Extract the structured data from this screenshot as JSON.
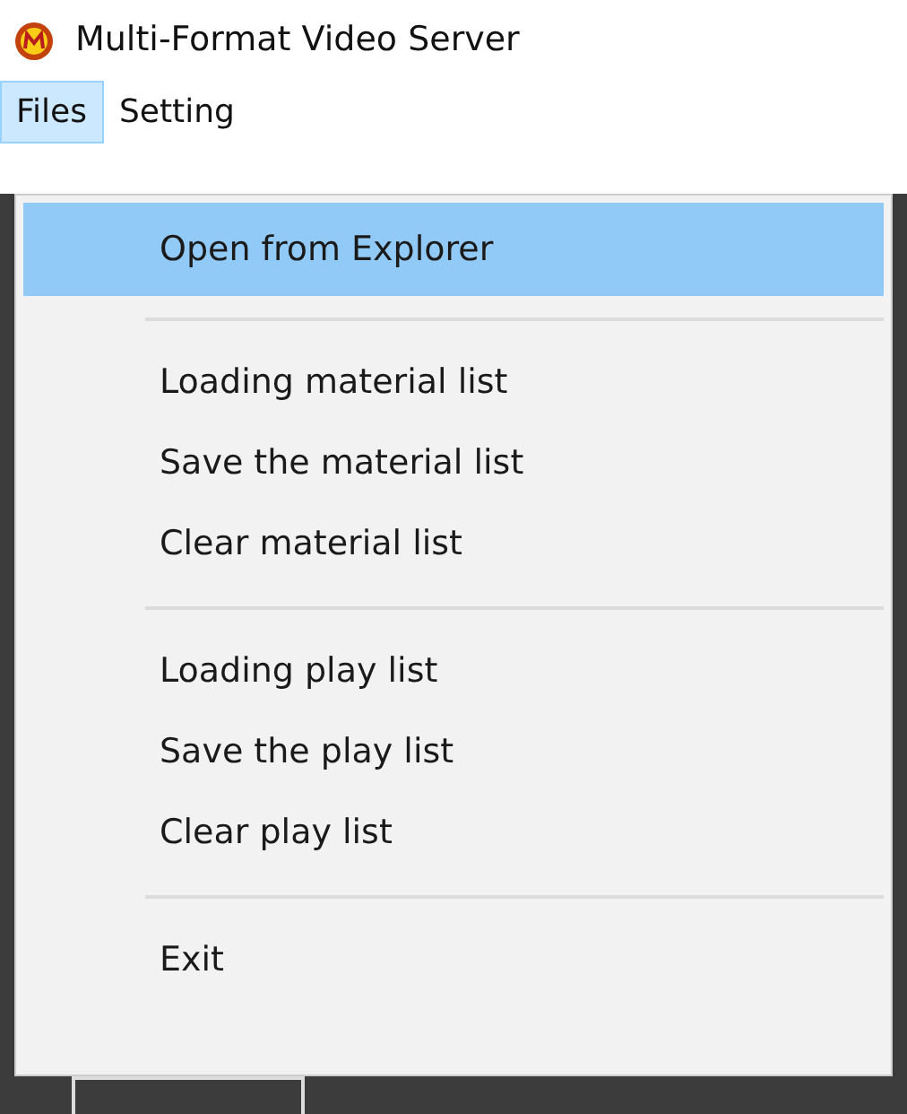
{
  "window": {
    "title": "Multi-Format Video Server"
  },
  "menu_bar": [
    {
      "label": "Files",
      "selected": true
    },
    {
      "label": "Setting",
      "selected": false
    }
  ],
  "menu": [
    {
      "kind": "item",
      "label": "Open from Explorer",
      "selected": true
    },
    {
      "kind": "separator"
    },
    {
      "kind": "item",
      "label": "Loading material list",
      "selected": false
    },
    {
      "kind": "item",
      "label": "Save the material list",
      "selected": false
    },
    {
      "kind": "item",
      "label": "Clear material list",
      "selected": false
    },
    {
      "kind": "separator"
    },
    {
      "kind": "item",
      "label": "Loading play list",
      "selected": false
    },
    {
      "kind": "item",
      "label": "Save the play list",
      "selected": false
    },
    {
      "kind": "item",
      "label": "Clear play list",
      "selected": false
    },
    {
      "kind": "separator"
    },
    {
      "kind": "item",
      "label": "Exit",
      "selected": false
    }
  ]
}
